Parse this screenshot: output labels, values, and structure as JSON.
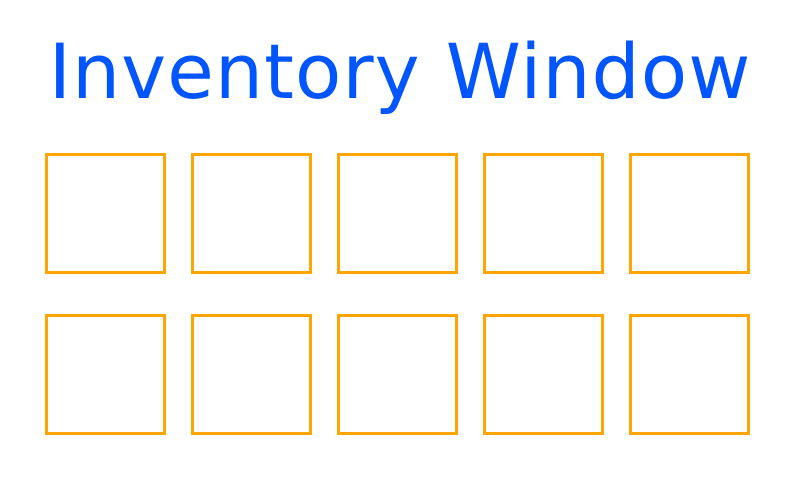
{
  "window": {
    "title": "Inventory Window"
  },
  "colors": {
    "title": "#0055ff",
    "slot_border": "#ffa500",
    "background": "#ffffff"
  },
  "inventory": {
    "rows": 2,
    "columns": 5,
    "slots": [
      {
        "item": ""
      },
      {
        "item": ""
      },
      {
        "item": ""
      },
      {
        "item": ""
      },
      {
        "item": ""
      },
      {
        "item": ""
      },
      {
        "item": ""
      },
      {
        "item": ""
      },
      {
        "item": ""
      },
      {
        "item": ""
      }
    ]
  }
}
